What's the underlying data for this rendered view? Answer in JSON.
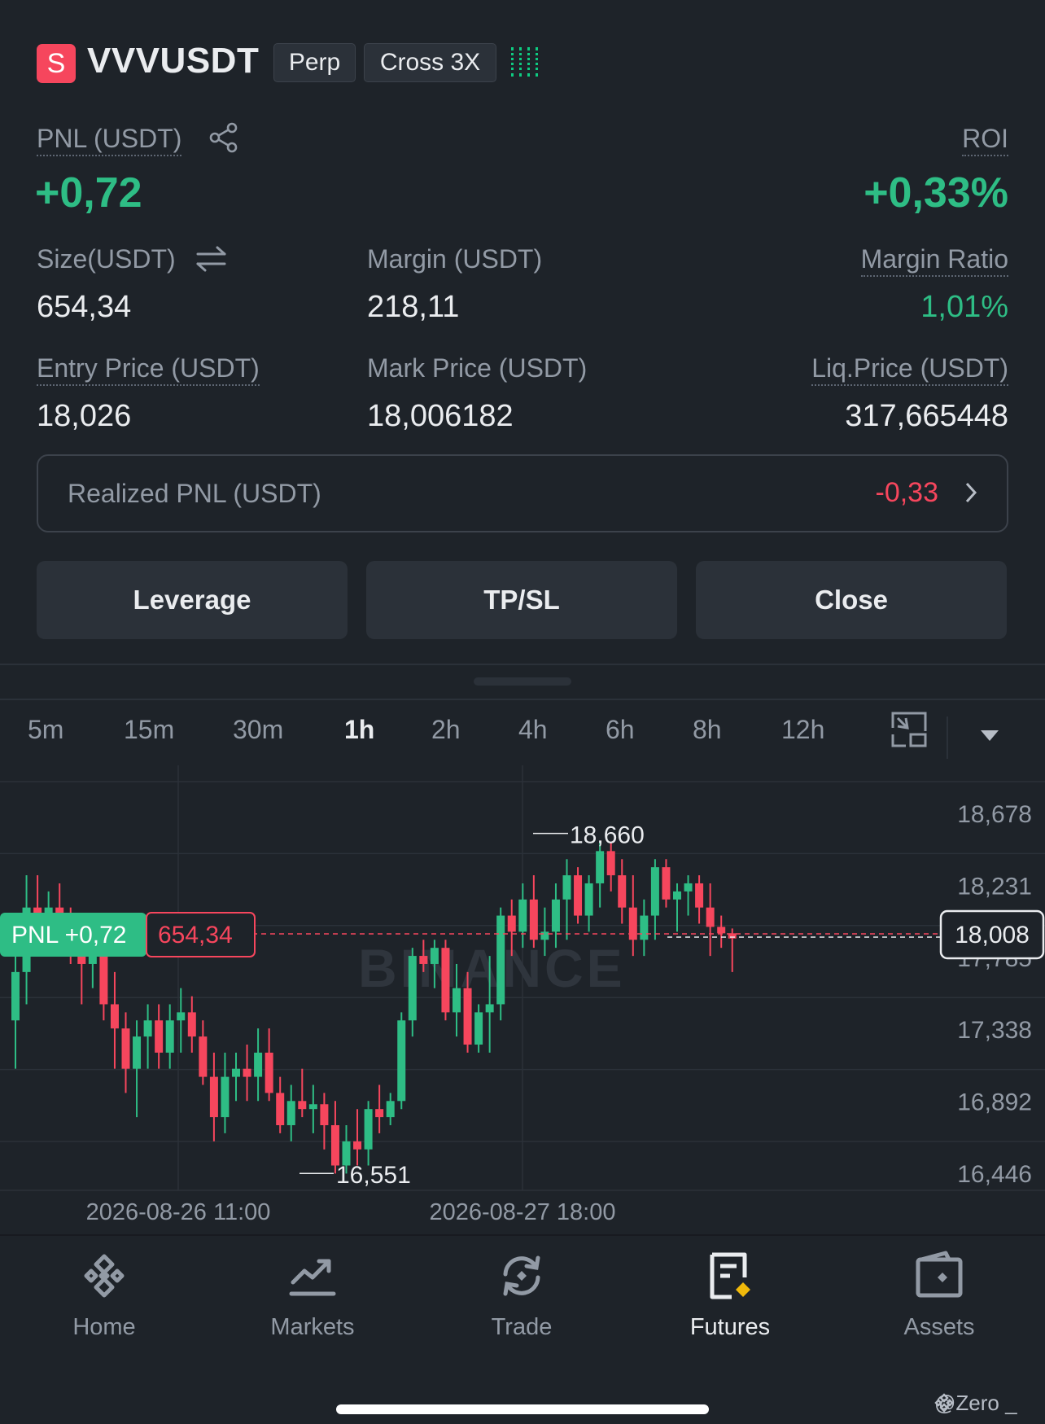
{
  "header": {
    "badge": "S",
    "symbol": "VVVUSDT",
    "tag_perp": "Perp",
    "tag_margin": "Cross 3X"
  },
  "position": {
    "pnl_label": "PNL (USDT)",
    "pnl_value": "+0,72",
    "roi_label": "ROI",
    "roi_value": "+0,33%",
    "size_label": "Size(USDT)",
    "size_value": "654,34",
    "margin_label": "Margin (USDT)",
    "margin_value": "218,11",
    "margin_ratio_label": "Margin Ratio",
    "margin_ratio_value": "1,01%",
    "entry_label": "Entry Price (USDT)",
    "entry_value": "18,026",
    "mark_label": "Mark Price (USDT)",
    "mark_value": "18,006182",
    "liq_label": "Liq.Price (USDT)",
    "liq_value": "317,665448",
    "realized_label": "Realized PNL (USDT)",
    "realized_value": "-0,33"
  },
  "actions": {
    "leverage": "Leverage",
    "tpsl": "TP/SL",
    "close": "Close"
  },
  "timeframes": [
    "5m",
    "15m",
    "30m",
    "1h",
    "2h",
    "4h",
    "6h",
    "8h",
    "12h"
  ],
  "active_timeframe": "1h",
  "chart_data": {
    "type": "candlestick",
    "interval": "1h",
    "y_ticks": [
      "18,678",
      "18,231",
      "17,785",
      "17,338",
      "16,892",
      "16,446"
    ],
    "x_ticks": [
      "2026-08-26 11:00",
      "2026-08-27 18:00"
    ],
    "high_marker": "18,660",
    "low_marker": "16,551",
    "current_price": "18,008",
    "position_pnl_tag": "PNL +0,72",
    "position_size_tag": "654,34",
    "watermark": "BINANCE",
    "up_color": "#2ebd85",
    "down_color": "#f6465d",
    "candles": [
      [
        17.5,
        17.9,
        17.2,
        17.8
      ],
      [
        17.8,
        18.4,
        17.6,
        18.2
      ],
      [
        18.2,
        18.4,
        17.9,
        18.1
      ],
      [
        18.1,
        18.3,
        17.9,
        18.2
      ],
      [
        18.2,
        18.35,
        17.9,
        18.1
      ],
      [
        18.1,
        18.2,
        17.85,
        18.0
      ],
      [
        18.0,
        18.15,
        17.6,
        17.85
      ],
      [
        17.85,
        18.1,
        17.7,
        18.0
      ],
      [
        18.0,
        18.1,
        17.5,
        17.6
      ],
      [
        17.6,
        17.8,
        17.2,
        17.45
      ],
      [
        17.45,
        17.55,
        17.05,
        17.2
      ],
      [
        17.2,
        17.5,
        16.9,
        17.4
      ],
      [
        17.4,
        17.6,
        17.2,
        17.5
      ],
      [
        17.5,
        17.6,
        17.2,
        17.3
      ],
      [
        17.3,
        17.6,
        17.2,
        17.5
      ],
      [
        17.5,
        17.7,
        17.3,
        17.55
      ],
      [
        17.55,
        17.65,
        17.3,
        17.4
      ],
      [
        17.4,
        17.5,
        17.1,
        17.15
      ],
      [
        17.15,
        17.3,
        16.75,
        16.9
      ],
      [
        16.9,
        17.3,
        16.8,
        17.15
      ],
      [
        17.15,
        17.3,
        17.0,
        17.2
      ],
      [
        17.2,
        17.35,
        17.0,
        17.15
      ],
      [
        17.15,
        17.45,
        17.0,
        17.3
      ],
      [
        17.3,
        17.45,
        17.0,
        17.05
      ],
      [
        17.05,
        17.15,
        16.8,
        16.85
      ],
      [
        16.85,
        17.1,
        16.75,
        17.0
      ],
      [
        17.0,
        17.2,
        16.9,
        16.95
      ],
      [
        16.95,
        17.1,
        16.8,
        16.98
      ],
      [
        16.98,
        17.05,
        16.7,
        16.85
      ],
      [
        16.85,
        17.0,
        16.55,
        16.6
      ],
      [
        16.6,
        16.85,
        16.55,
        16.75
      ],
      [
        16.75,
        16.95,
        16.6,
        16.7
      ],
      [
        16.7,
        17.0,
        16.6,
        16.95
      ],
      [
        16.95,
        17.1,
        16.8,
        16.9
      ],
      [
        16.9,
        17.05,
        16.85,
        17.0
      ],
      [
        17.0,
        17.55,
        16.95,
        17.5
      ],
      [
        17.5,
        17.95,
        17.4,
        17.9
      ],
      [
        17.9,
        18.0,
        17.8,
        17.85
      ],
      [
        17.85,
        18.0,
        17.7,
        17.95
      ],
      [
        17.95,
        18.0,
        17.5,
        17.55
      ],
      [
        17.55,
        17.85,
        17.4,
        17.7
      ],
      [
        17.7,
        17.8,
        17.3,
        17.35
      ],
      [
        17.35,
        17.6,
        17.3,
        17.55
      ],
      [
        17.55,
        17.9,
        17.3,
        17.6
      ],
      [
        17.6,
        18.2,
        17.5,
        18.15
      ],
      [
        18.15,
        18.25,
        17.9,
        18.05
      ],
      [
        18.05,
        18.35,
        17.95,
        18.25
      ],
      [
        18.25,
        18.4,
        17.95,
        18.0
      ],
      [
        18.0,
        18.2,
        17.9,
        18.05
      ],
      [
        18.05,
        18.35,
        17.95,
        18.25
      ],
      [
        18.25,
        18.5,
        18.0,
        18.4
      ],
      [
        18.4,
        18.45,
        18.1,
        18.15
      ],
      [
        18.15,
        18.4,
        18.05,
        18.35
      ],
      [
        18.35,
        18.6,
        18.2,
        18.55
      ],
      [
        18.55,
        18.6,
        18.3,
        18.4
      ],
      [
        18.4,
        18.5,
        18.1,
        18.2
      ],
      [
        18.2,
        18.4,
        17.9,
        18.0
      ],
      [
        18.0,
        18.25,
        17.9,
        18.15
      ],
      [
        18.15,
        18.5,
        18.0,
        18.45
      ],
      [
        18.45,
        18.5,
        18.2,
        18.25
      ],
      [
        18.25,
        18.35,
        18.05,
        18.3
      ],
      [
        18.3,
        18.4,
        18.15,
        18.35
      ],
      [
        18.35,
        18.4,
        18.1,
        18.2
      ],
      [
        18.2,
        18.35,
        17.9,
        18.08
      ],
      [
        18.08,
        18.15,
        17.95,
        18.04
      ],
      [
        18.04,
        18.07,
        17.8,
        18.008
      ]
    ]
  },
  "nav": {
    "home": "Home",
    "markets": "Markets",
    "trade": "Trade",
    "futures": "Futures",
    "assets": "Assets"
  },
  "watermark_user": "@Zero _"
}
